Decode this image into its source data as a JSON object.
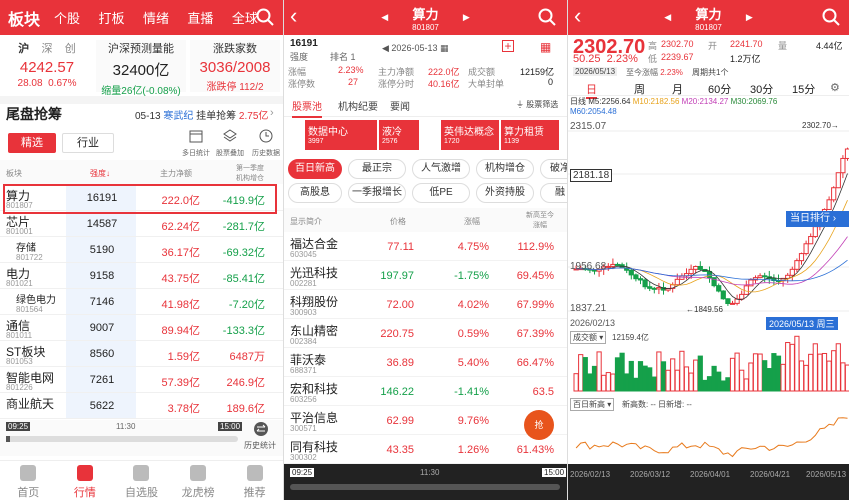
{
  "p1": {
    "title": "板块",
    "tabs": [
      "个股",
      "打板",
      "情绪",
      "直播",
      "全球"
    ],
    "indices": [
      {
        "name": "沪",
        "name2": "深",
        "name3": "创",
        "value": "4242.57",
        "chg": "28.08",
        "pct": "0.67%"
      },
      {
        "name": "沪深预测量能",
        "value": "32400亿",
        "sub": "缩量26亿(-0.08%)"
      },
      {
        "name": "涨跌家数",
        "value": "3036/2008",
        "sub": "涨跌停 112/2"
      }
    ],
    "section": "尾盘抢筹",
    "date": "05-13",
    "event": "寒武纪",
    "event2": "挂单抢筹",
    "amount": "2.75亿",
    "btn_a": "精选",
    "btn_b": "行业",
    "tool1": "多日统计",
    "tool2": "股票叠加",
    "tool3": "历史数据",
    "headers": [
      "板块",
      "强度",
      "主力净额",
      "第一季度\n机构增仓"
    ],
    "rows": [
      {
        "name": "算力",
        "code": "801807",
        "s": "16191",
        "m": "222.0亿",
        "j": "-419.9亿"
      },
      {
        "name": "芯片",
        "code": "801001",
        "s": "14587",
        "m": "62.24亿",
        "j": "-281.7亿"
      },
      {
        "name": "存储",
        "code": "801722",
        "s": "5190",
        "m": "36.17亿",
        "j": "-69.32亿"
      },
      {
        "name": "电力",
        "code": "801021",
        "s": "9158",
        "m": "43.75亿",
        "j": "-85.41亿"
      },
      {
        "name": "绿色电力",
        "code": "801564",
        "s": "7146",
        "m": "41.98亿",
        "j": "-7.20亿"
      },
      {
        "name": "通信",
        "code": "801011",
        "s": "9007",
        "m": "89.94亿",
        "j": "-133.3亿"
      },
      {
        "name": "ST板块",
        "code": "801053",
        "s": "8560",
        "m": "1.59亿",
        "j": "6487万"
      },
      {
        "name": "智能电网",
        "code": "801226",
        "s": "7261",
        "m": "57.39亿",
        "j": "246.9亿"
      },
      {
        "name": "商业航天",
        "code": "",
        "s": "5622",
        "m": "3.78亿",
        "j": "189.6亿"
      }
    ],
    "time_start": "09:25",
    "time_mid": "11:30",
    "time_end": "15:00",
    "hist": "历史统计",
    "nav": [
      "首页",
      "行情",
      "自选股",
      "龙虎榜",
      "推荐"
    ]
  },
  "p2": {
    "title": "算力",
    "code": "801807",
    "strength": "16191",
    "rank": "排名 1",
    "date": "2026-05-13",
    "stats": [
      [
        "涨幅",
        "2.23%"
      ],
      [
        "主力净额",
        "222.0亿"
      ],
      [
        "成交额",
        "12159亿"
      ],
      [
        "涨停数",
        "27"
      ],
      [
        "涨停分时",
        "40.16亿"
      ],
      [
        "大单封单",
        "0"
      ]
    ],
    "tabs": [
      "股票池",
      "机构纪要",
      "要闻"
    ],
    "filter": "股票筛选",
    "cats": [
      {
        "n": "数据中心",
        "v": "3997"
      },
      {
        "n": "液冷",
        "v": "2576"
      },
      {
        "n": "英伟达概念",
        "v": "1720"
      },
      {
        "n": "算力租赁",
        "v": "1139"
      }
    ],
    "chips": [
      "百日新高",
      "最正宗",
      "人气激增",
      "机构增仓",
      "破净",
      "高股息",
      "一季报增长",
      "低PE",
      "外资持股",
      "融"
    ],
    "headers": [
      "显示简介",
      "价格",
      "涨幅",
      "新高至今\n涨幅"
    ],
    "rows": [
      {
        "name": "福达合金",
        "code": "603045",
        "p": "77.11",
        "c": "4.75%",
        "h": "112.9%"
      },
      {
        "name": "光迅科技",
        "code": "002281",
        "p": "197.97",
        "c": "-1.75%",
        "h": "69.45%"
      },
      {
        "name": "科翔股份",
        "code": "300903",
        "p": "72.00",
        "c": "4.02%",
        "h": "67.99%"
      },
      {
        "name": "东山精密",
        "code": "002384",
        "p": "220.75",
        "c": "0.59%",
        "h": "67.39%"
      },
      {
        "name": "菲沃泰",
        "code": "688371",
        "p": "36.89",
        "c": "5.40%",
        "h": "66.47%"
      },
      {
        "name": "宏和科技",
        "code": "603256",
        "p": "146.22",
        "c": "-1.41%",
        "h": "63.5"
      },
      {
        "name": "平治信息",
        "code": "300571",
        "p": "62.99",
        "c": "9.76%",
        "h": ""
      },
      {
        "name": "同有科技",
        "code": "300302",
        "p": "43.35",
        "c": "1.26%",
        "h": "61.43%"
      }
    ],
    "time_start": "09:25",
    "time_mid": "11:30",
    "time_end": "15:00"
  },
  "p3": {
    "title": "算力",
    "code": "801807",
    "price": "2302.70",
    "chg": "50.25",
    "pct": "2.23%",
    "high_l": "高",
    "high": "2302.70",
    "open_l": "开",
    "open": "2241.70",
    "vol_l": "量",
    "vol": "4.44亿",
    "low_l": "低",
    "low": "2239.67",
    "amt": "1.2万亿",
    "date": "2026/05/13",
    "since": "至今涨幅",
    "since_v": "2.23%",
    "week": "周期共1个",
    "tabs": [
      "日",
      "周",
      "月",
      "60分",
      "30分",
      "15分"
    ],
    "ma": "日线 M5:2256.64",
    "ma10": "M10:2182.56",
    "ma20": "M20:2134.27",
    "ma30": "M30:2069.76",
    "ma60": "M60:2054.48",
    "y1": "2315.07",
    "y2": "2181.18",
    "y3": "1956.68",
    "y4": "1837.21",
    "lowlbl": "1849.56",
    "peak": "2302.70",
    "d1": "2026/02/13",
    "d2": "2026/05/13 周三",
    "rank_btn": "当日排行",
    "vol_lbl": "成交额",
    "vol_v": "12159.4亿",
    "ind": "百日新高",
    "ind2": "新高数: -- 日新增: --",
    "xd": [
      "2026/02/13",
      "2026/03/12",
      "2026/04/01",
      "2026/04/21",
      "2026/05/13"
    ]
  }
}
